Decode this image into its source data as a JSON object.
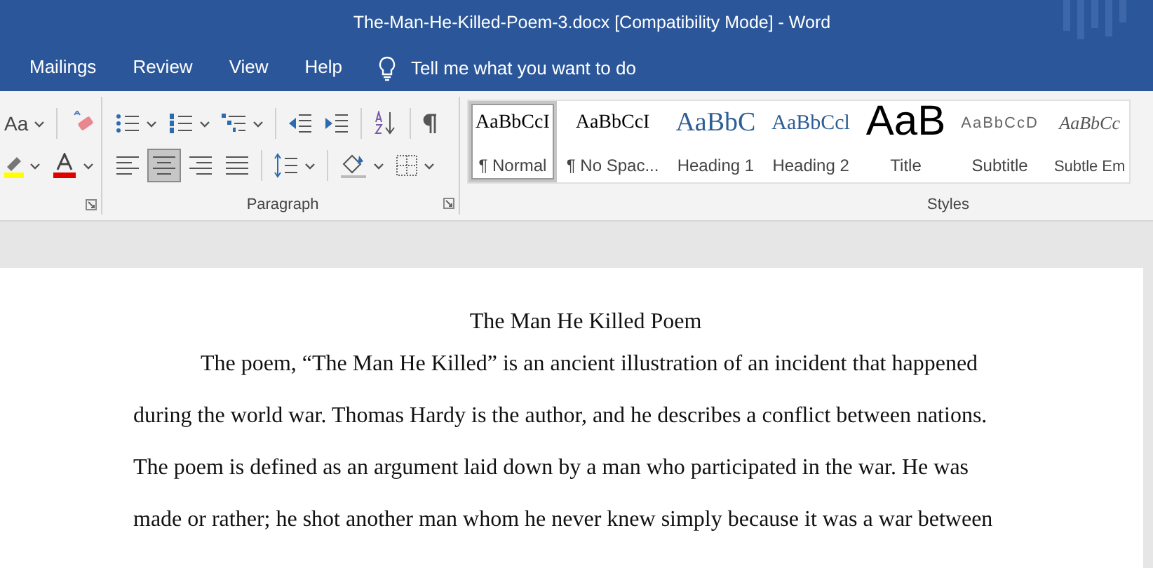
{
  "window": {
    "title": "The-Man-He-Killed-Poem-3.docx [Compatibility Mode]  -  Word"
  },
  "tabs": [
    {
      "label": "Mailings",
      "selected": false
    },
    {
      "label": "Review",
      "selected": false
    },
    {
      "label": "View",
      "selected": false
    },
    {
      "label": "Help",
      "selected": false
    }
  ],
  "tell_me": {
    "placeholder": "Tell me what you want to do"
  },
  "font_group": {
    "change_case": "Aa"
  },
  "paragraph_group": {
    "label": "Paragraph",
    "alignment": [
      {
        "kind": "left",
        "selected": false
      },
      {
        "kind": "center",
        "selected": true
      },
      {
        "kind": "right",
        "selected": false
      },
      {
        "kind": "justify",
        "selected": false
      }
    ]
  },
  "styles_group": {
    "label": "Styles",
    "items": [
      {
        "kind": "normal",
        "preview": "AaBbCcI",
        "label": "¶ Normal",
        "selected": true
      },
      {
        "kind": "nospacing",
        "preview": "AaBbCcI",
        "label": "¶ No Spac...",
        "selected": false
      },
      {
        "kind": "heading1",
        "preview": "AaBbC",
        "label": "Heading 1",
        "selected": false
      },
      {
        "kind": "heading2",
        "preview": "AaBbCcl",
        "label": "Heading 2",
        "selected": false
      },
      {
        "kind": "title",
        "preview": "AaB",
        "label": "Title",
        "selected": false
      },
      {
        "kind": "subtitle",
        "preview": "AaBbCcD",
        "label": "Subtitle",
        "selected": false
      },
      {
        "kind": "emphasis",
        "preview": "AaBbCc",
        "label": "Subtle Em",
        "selected": false
      }
    ]
  },
  "document": {
    "heading": "The Man He Killed Poem",
    "paragraphs": [
      "The poem, “The Man He Killed” is an ancient illustration of an incident that happened during the world war. Thomas Hardy is the author, and he describes a conflict between nations. The poem is defined as an argument laid down by a man who participated in the war. He was made or rather; he shot another man whom he never knew simply because it was a war between"
    ]
  }
}
